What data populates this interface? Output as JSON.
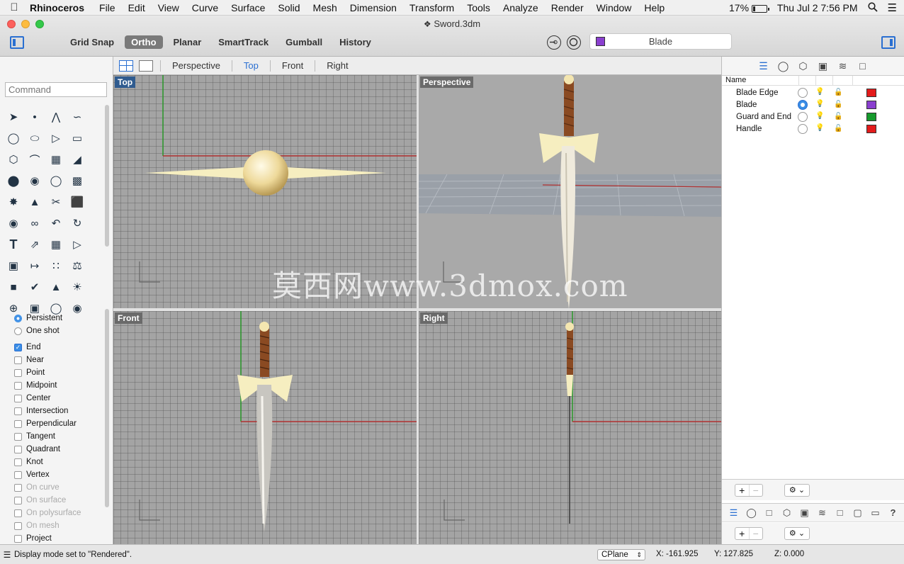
{
  "menubar": {
    "app_name": "Rhinoceros",
    "items": [
      "File",
      "Edit",
      "View",
      "Curve",
      "Surface",
      "Solid",
      "Mesh",
      "Dimension",
      "Transform",
      "Tools",
      "Analyze",
      "Render",
      "Window",
      "Help"
    ],
    "battery": "17%",
    "battery_level": 0.17,
    "clock": "Thu Jul 2  7:56 PM"
  },
  "window": {
    "title": "Sword.3dm",
    "modes": [
      "Grid Snap",
      "Ortho",
      "Planar",
      "SmartTrack",
      "Gumball",
      "History"
    ],
    "active_mode": "Ortho",
    "current_layer": "Blade",
    "current_layer_color": "#8a3fcf"
  },
  "viewport_tabs": {
    "tabs": [
      "Perspective",
      "Top",
      "Front",
      "Right"
    ],
    "active": "Top"
  },
  "command": {
    "placeholder": "Command"
  },
  "osnap": {
    "modes": [
      {
        "label": "Persistent",
        "type": "radio",
        "checked": true,
        "disabled": false
      },
      {
        "label": "One shot",
        "type": "radio",
        "checked": false,
        "disabled": false
      }
    ],
    "snaps": [
      {
        "label": "End",
        "checked": true,
        "disabled": false
      },
      {
        "label": "Near",
        "checked": false,
        "disabled": false
      },
      {
        "label": "Point",
        "checked": false,
        "disabled": false
      },
      {
        "label": "Midpoint",
        "checked": false,
        "disabled": false
      },
      {
        "label": "Center",
        "checked": false,
        "disabled": false
      },
      {
        "label": "Intersection",
        "checked": false,
        "disabled": false
      },
      {
        "label": "Perpendicular",
        "checked": false,
        "disabled": false
      },
      {
        "label": "Tangent",
        "checked": false,
        "disabled": false
      },
      {
        "label": "Quadrant",
        "checked": false,
        "disabled": false
      },
      {
        "label": "Knot",
        "checked": false,
        "disabled": false
      },
      {
        "label": "Vertex",
        "checked": false,
        "disabled": false
      },
      {
        "label": "On curve",
        "checked": false,
        "disabled": true
      },
      {
        "label": "On surface",
        "checked": false,
        "disabled": true
      },
      {
        "label": "On polysurface",
        "checked": false,
        "disabled": true
      },
      {
        "label": "On mesh",
        "checked": false,
        "disabled": true
      },
      {
        "label": "Project",
        "checked": false,
        "disabled": false
      }
    ]
  },
  "viewports": {
    "top": "Top",
    "perspective": "Perspective",
    "front": "Front",
    "right": "Right",
    "watermark": "莫西网www.3dmox.com"
  },
  "layers": {
    "header": "Name",
    "items": [
      {
        "name": "Blade Edge",
        "current": false,
        "color": "#e31b1b"
      },
      {
        "name": "Blade",
        "current": true,
        "color": "#8a3fcf"
      },
      {
        "name": "Guard and End",
        "current": false,
        "color": "#169a2c"
      },
      {
        "name": "Handle",
        "current": false,
        "color": "#e31b1b"
      }
    ]
  },
  "status": {
    "message": "Display mode set to \"Rendered\".",
    "cplane": "CPlane",
    "x": "X: -161.925",
    "y": "Y: 127.825",
    "z": "Z: 0.000"
  }
}
